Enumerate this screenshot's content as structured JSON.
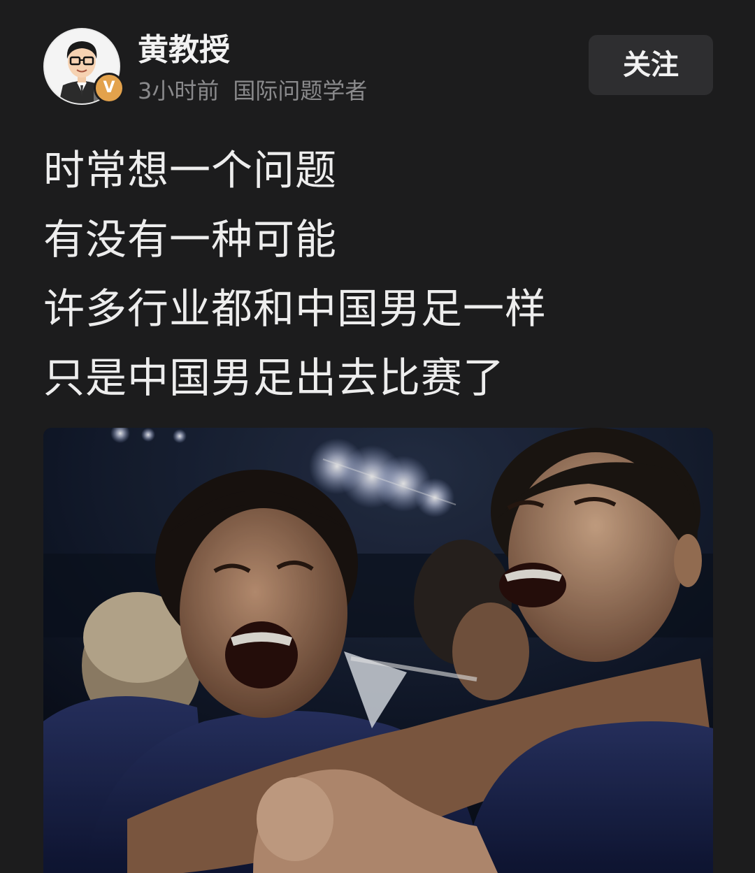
{
  "author": {
    "name": "黄教授",
    "avatar_icon": "cartoon-avatar-icon",
    "verified_badge_label": "V",
    "badge_color": "#e3a24c",
    "time_ago": "3小时前",
    "title": "国际问题学者"
  },
  "follow_button_label": "关注",
  "post": {
    "lines": [
      "时常想一个问题",
      "有没有一种可能",
      "许多行业都和中国男足一样",
      "只是中国男足出去比赛了"
    ]
  },
  "photo": {
    "description_icon": "football-celebration-photo"
  },
  "colors": {
    "background": "#1c1c1d",
    "text": "#ededed",
    "muted": "#8a8a8c",
    "button_bg": "#2e2e30"
  }
}
